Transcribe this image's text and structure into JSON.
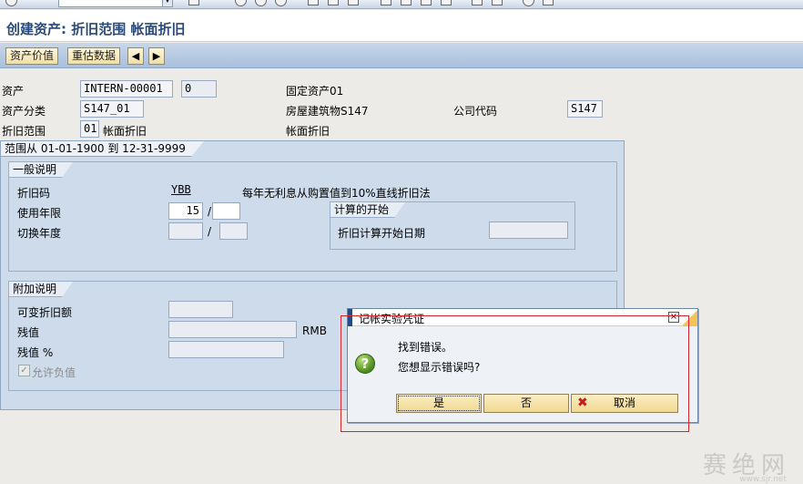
{
  "toolbar": {
    "icons": [
      "back-icon",
      "save-icon",
      "exit-icon",
      "cancel-icon",
      "print-icon",
      "find-icon",
      "find-next-icon",
      "first-page-icon",
      "prev-page-icon",
      "next-page-icon",
      "last-page-icon",
      "new-session-icon",
      "shortcut-icon",
      "help-icon",
      "layout-icon"
    ]
  },
  "title": "创建资产: 折旧范围 帐面折旧",
  "app_toolbar": {
    "asset_value_label": "资产价值",
    "revaluation_label": "重估数据"
  },
  "header": {
    "asset_label": "资产",
    "asset_number": "INTERN-00001",
    "asset_subnumber": "0",
    "asset_description": "固定资产01",
    "asset_class_label": "资产分类",
    "asset_class": "S147_01",
    "asset_class_description": "房屋建筑物S147",
    "company_code_label": "公司代码",
    "company_code": "S147",
    "depr_area_label": "折旧范围",
    "depr_area": "01",
    "depr_area_name": "帐面折旧",
    "depr_area_name2": "帐面折旧"
  },
  "panel": {
    "range_label": "范围从 01-01-1900 到 12-31-9999",
    "general": {
      "title": "一般说明",
      "depr_key_label": "折旧码",
      "depr_key": "YBB",
      "depr_key_desc": "每年无利息从购置值到10%直线折旧法",
      "useful_life_label": "使用年限",
      "useful_life_years": "15",
      "useful_life_periods": "",
      "slash": "/",
      "changeover_year_label": "切换年度",
      "start_calc": {
        "title": "计算的开始",
        "start_date_label": "折旧计算开始日期",
        "start_date": ""
      }
    },
    "additional": {
      "title": "附加说明",
      "variable_depr_label": "可变折旧额",
      "scrap_value_label": "残值",
      "currency": "RMB",
      "scrap_pct_label": "残值 %",
      "allow_negative_label": "允许负值",
      "allow_negative_checked": true
    }
  },
  "dialog": {
    "title": "记帐实验凭证",
    "line1": "找到错误。",
    "line2": "您想显示错误吗?",
    "yes_label": "是",
    "no_label": "否",
    "cancel_label": "取消"
  },
  "watermark": {
    "text": "赛绝网",
    "sub": "www.sjr.net"
  }
}
